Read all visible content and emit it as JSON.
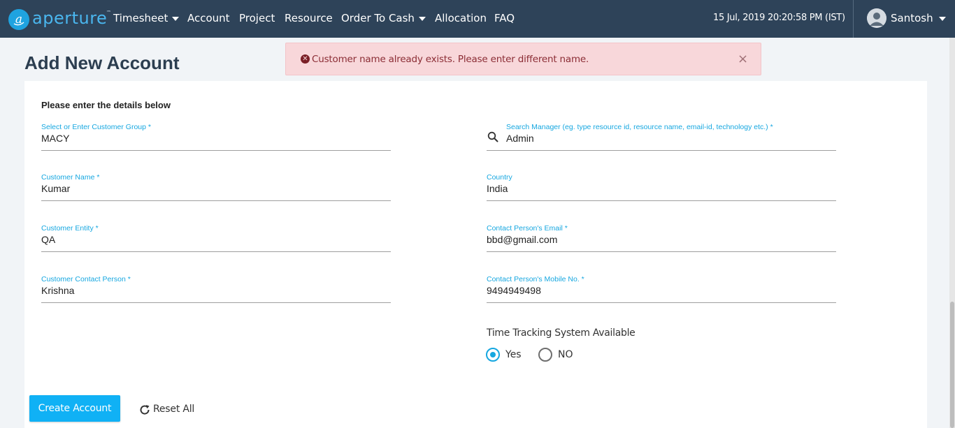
{
  "nav": {
    "brand": "aperture",
    "brand_tm": "™",
    "items": [
      {
        "label": "Timesheet"
      },
      {
        "label": "Account"
      },
      {
        "label": "Project"
      },
      {
        "label": "Resource"
      },
      {
        "label": "Order To Cash"
      },
      {
        "label": "Allocation"
      },
      {
        "label": "FAQ"
      }
    ],
    "datetime": "15 Jul, 2019 20:20:58 PM (IST)",
    "user": "Santosh"
  },
  "page": {
    "title": "Add New Account"
  },
  "alert": {
    "message": "Customer name already exists. Please enter different name.",
    "close": "×",
    "icon": "x-circle-icon"
  },
  "form": {
    "section_label": "Please enter the details below",
    "customer_group": {
      "label": "Select or Enter Customer Group *",
      "value": "MACY"
    },
    "search_manager": {
      "label": "Search Manager (eg. type resource id, resource name, email-id, technology etc.) *",
      "value": "Admin"
    },
    "customer_name": {
      "label": "Customer Name *",
      "value": "Kumar"
    },
    "country": {
      "label": "Country",
      "value": "India"
    },
    "customer_entity": {
      "label": "Customer Entity *",
      "value": "QA"
    },
    "contact_email": {
      "label": "Contact Person's Email *",
      "value": "bbd@gmail.com"
    },
    "contact_person": {
      "label": "Customer Contact Person *",
      "value": "Krishna"
    },
    "contact_mobile": {
      "label": "Contact Person's Mobile No. *",
      "value": "9494949498"
    },
    "time_tracking": {
      "label": "Time Tracking System Available",
      "options": [
        "Yes",
        "NO"
      ],
      "selected": "Yes"
    }
  },
  "actions": {
    "create": "Create Account",
    "reset": "Reset All"
  },
  "colors": {
    "navbar": "#2e4359",
    "accent": "#16a7e0",
    "alert_bg": "#f8d7da",
    "alert_text": "#8b2d35"
  }
}
